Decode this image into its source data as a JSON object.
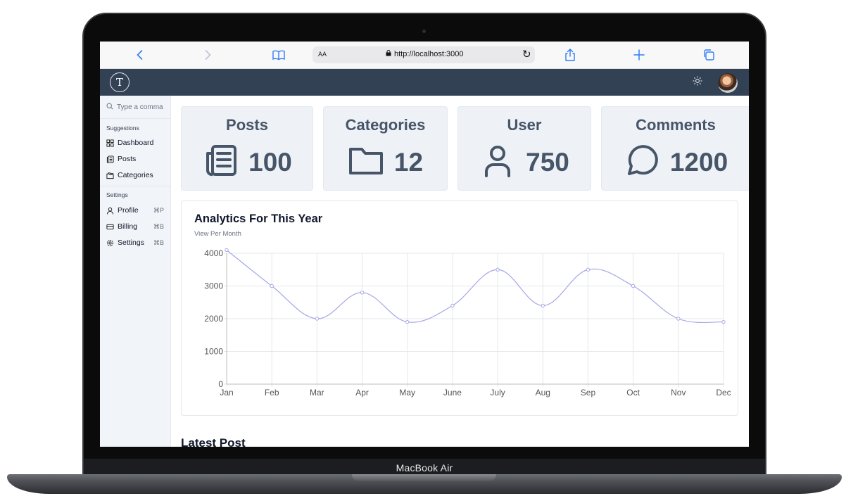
{
  "device": {
    "label": "MacBook Air"
  },
  "browser": {
    "aa_label": "AA",
    "url": "http://localhost:3000",
    "icons": [
      "back-icon",
      "forward-icon",
      "book-icon",
      "lock-icon",
      "reload-icon",
      "share-icon",
      "plus-icon",
      "tabs-icon"
    ]
  },
  "header": {
    "logo_glyph": "T",
    "theme_icon": "sun-icon",
    "avatar": "user-avatar"
  },
  "sidebar": {
    "search_placeholder": "Type a comma",
    "suggestions_label": "Suggestions",
    "suggestions": [
      {
        "label": "Dashboard",
        "icon": "dashboard-icon"
      },
      {
        "label": "Posts",
        "icon": "newspaper-icon"
      },
      {
        "label": "Categories",
        "icon": "folders-icon"
      }
    ],
    "settings_label": "Settings",
    "settings": [
      {
        "label": "Profile",
        "shortcut": "⌘P",
        "icon": "user-icon"
      },
      {
        "label": "Billing",
        "shortcut": "⌘B",
        "icon": "credit-card-icon"
      },
      {
        "label": "Settings",
        "shortcut": "⌘B",
        "icon": "gear-icon"
      }
    ]
  },
  "stats": [
    {
      "title": "Posts",
      "value": "100",
      "icon": "newspaper-icon"
    },
    {
      "title": "Categories",
      "value": "12",
      "icon": "folder-icon"
    },
    {
      "title": "User",
      "value": "750",
      "icon": "user-icon"
    },
    {
      "title": "Comments",
      "value": "1200",
      "icon": "message-circle-icon"
    }
  ],
  "analytics": {
    "title": "Analytics For This Year",
    "subtitle": "View Per Month"
  },
  "latest": {
    "title": "Latest Post"
  },
  "colors": {
    "header_bg": "#334155",
    "sidebar_bg": "#f1f4f9",
    "card_bg": "#eef2f7",
    "card_text": "#475569",
    "line": "#a5a6e6",
    "safari_accent": "#2f7cf6"
  },
  "chart_data": {
    "type": "line",
    "categories": [
      "Jan",
      "Feb",
      "Mar",
      "Apr",
      "May",
      "June",
      "July",
      "Aug",
      "Sep",
      "Oct",
      "Nov",
      "Dec"
    ],
    "series": [
      {
        "values": [
          4100,
          3000,
          2000,
          2800,
          1900,
          2400,
          3500,
          2400,
          3500,
          3000,
          2000,
          1900
        ]
      }
    ],
    "yticks": [
      0,
      1000,
      2000,
      3000,
      4000
    ],
    "ylim": [
      0,
      4000
    ],
    "grid": true,
    "xlabel": "",
    "ylabel": ""
  }
}
